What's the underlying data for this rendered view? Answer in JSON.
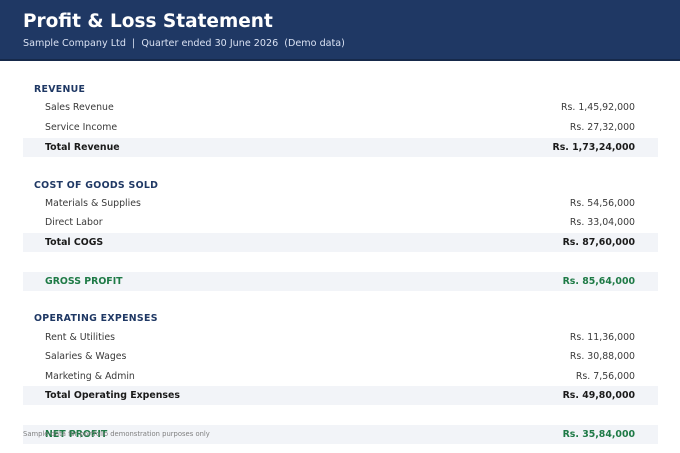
{
  "header": {
    "title": "Profit & Loss Statement",
    "subtitle": "Sample Company Ltd  |  Quarter ended 30 June 2026  (Demo data)"
  },
  "revenue": {
    "heading": "REVENUE",
    "items": [
      {
        "label": "Sales Revenue",
        "amount": "Rs. 1,45,92,000"
      },
      {
        "label": "Service Income",
        "amount": "Rs. 27,32,000"
      }
    ],
    "total": {
      "label": "Total Revenue",
      "amount": "Rs. 1,73,24,000"
    }
  },
  "cogs": {
    "heading": "COST OF GOODS SOLD",
    "items": [
      {
        "label": "Materials & Supplies",
        "amount": "Rs. 54,56,000"
      },
      {
        "label": "Direct Labor",
        "amount": "Rs. 33,04,000"
      }
    ],
    "total": {
      "label": "Total COGS",
      "amount": "Rs. 87,60,000"
    }
  },
  "gross_profit": {
    "label": "GROSS PROFIT",
    "amount": "Rs. 85,64,000"
  },
  "opex": {
    "heading": "OPERATING EXPENSES",
    "items": [
      {
        "label": "Rent & Utilities",
        "amount": "Rs. 11,36,000"
      },
      {
        "label": "Salaries & Wages",
        "amount": "Rs. 30,88,000"
      },
      {
        "label": "Marketing & Admin",
        "amount": "Rs. 7,56,000"
      }
    ],
    "total": {
      "label": "Total Operating Expenses",
      "amount": "Rs. 49,80,000"
    }
  },
  "net_profit": {
    "label": "NET PROFIT",
    "amount": "Rs. 35,84,000"
  },
  "footnote": "Sample data for portfolio demonstration purposes only",
  "colors": {
    "header_bg": "#1f3864",
    "section_heading": "#1f3864",
    "profit_text": "#1e7a46",
    "total_row_bg": "#f2f4f8"
  }
}
